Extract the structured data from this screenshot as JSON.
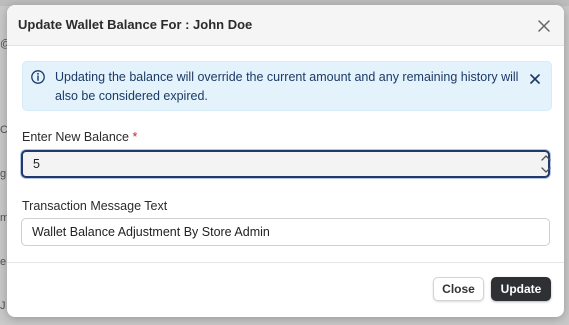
{
  "modal": {
    "title": "Update Wallet Balance For : John Doe",
    "alert": {
      "text": "Updating the balance will override the current amount and any remaining history will also be considered expired."
    },
    "balance": {
      "label": "Enter New Balance",
      "required_mark": "*",
      "value": "5"
    },
    "message": {
      "label": "Transaction Message Text",
      "value": "Wallet Balance Adjustment By Store Admin"
    },
    "buttons": {
      "close": "Close",
      "update": "Update"
    }
  },
  "background": {
    "fragments": [
      "@",
      "C",
      "g",
      "m",
      "e",
      "J"
    ]
  },
  "colors": {
    "alert_bg": "#e3f2fb",
    "alert_text": "#1b3a66",
    "primary_button": "#2f3033",
    "focus_border": "#1e3a6e",
    "required": "#c62828"
  },
  "icons": {
    "header_close": "close-icon",
    "alert_info": "info-icon",
    "alert_close": "close-icon",
    "stepper": "chevron-up-down-icon"
  }
}
